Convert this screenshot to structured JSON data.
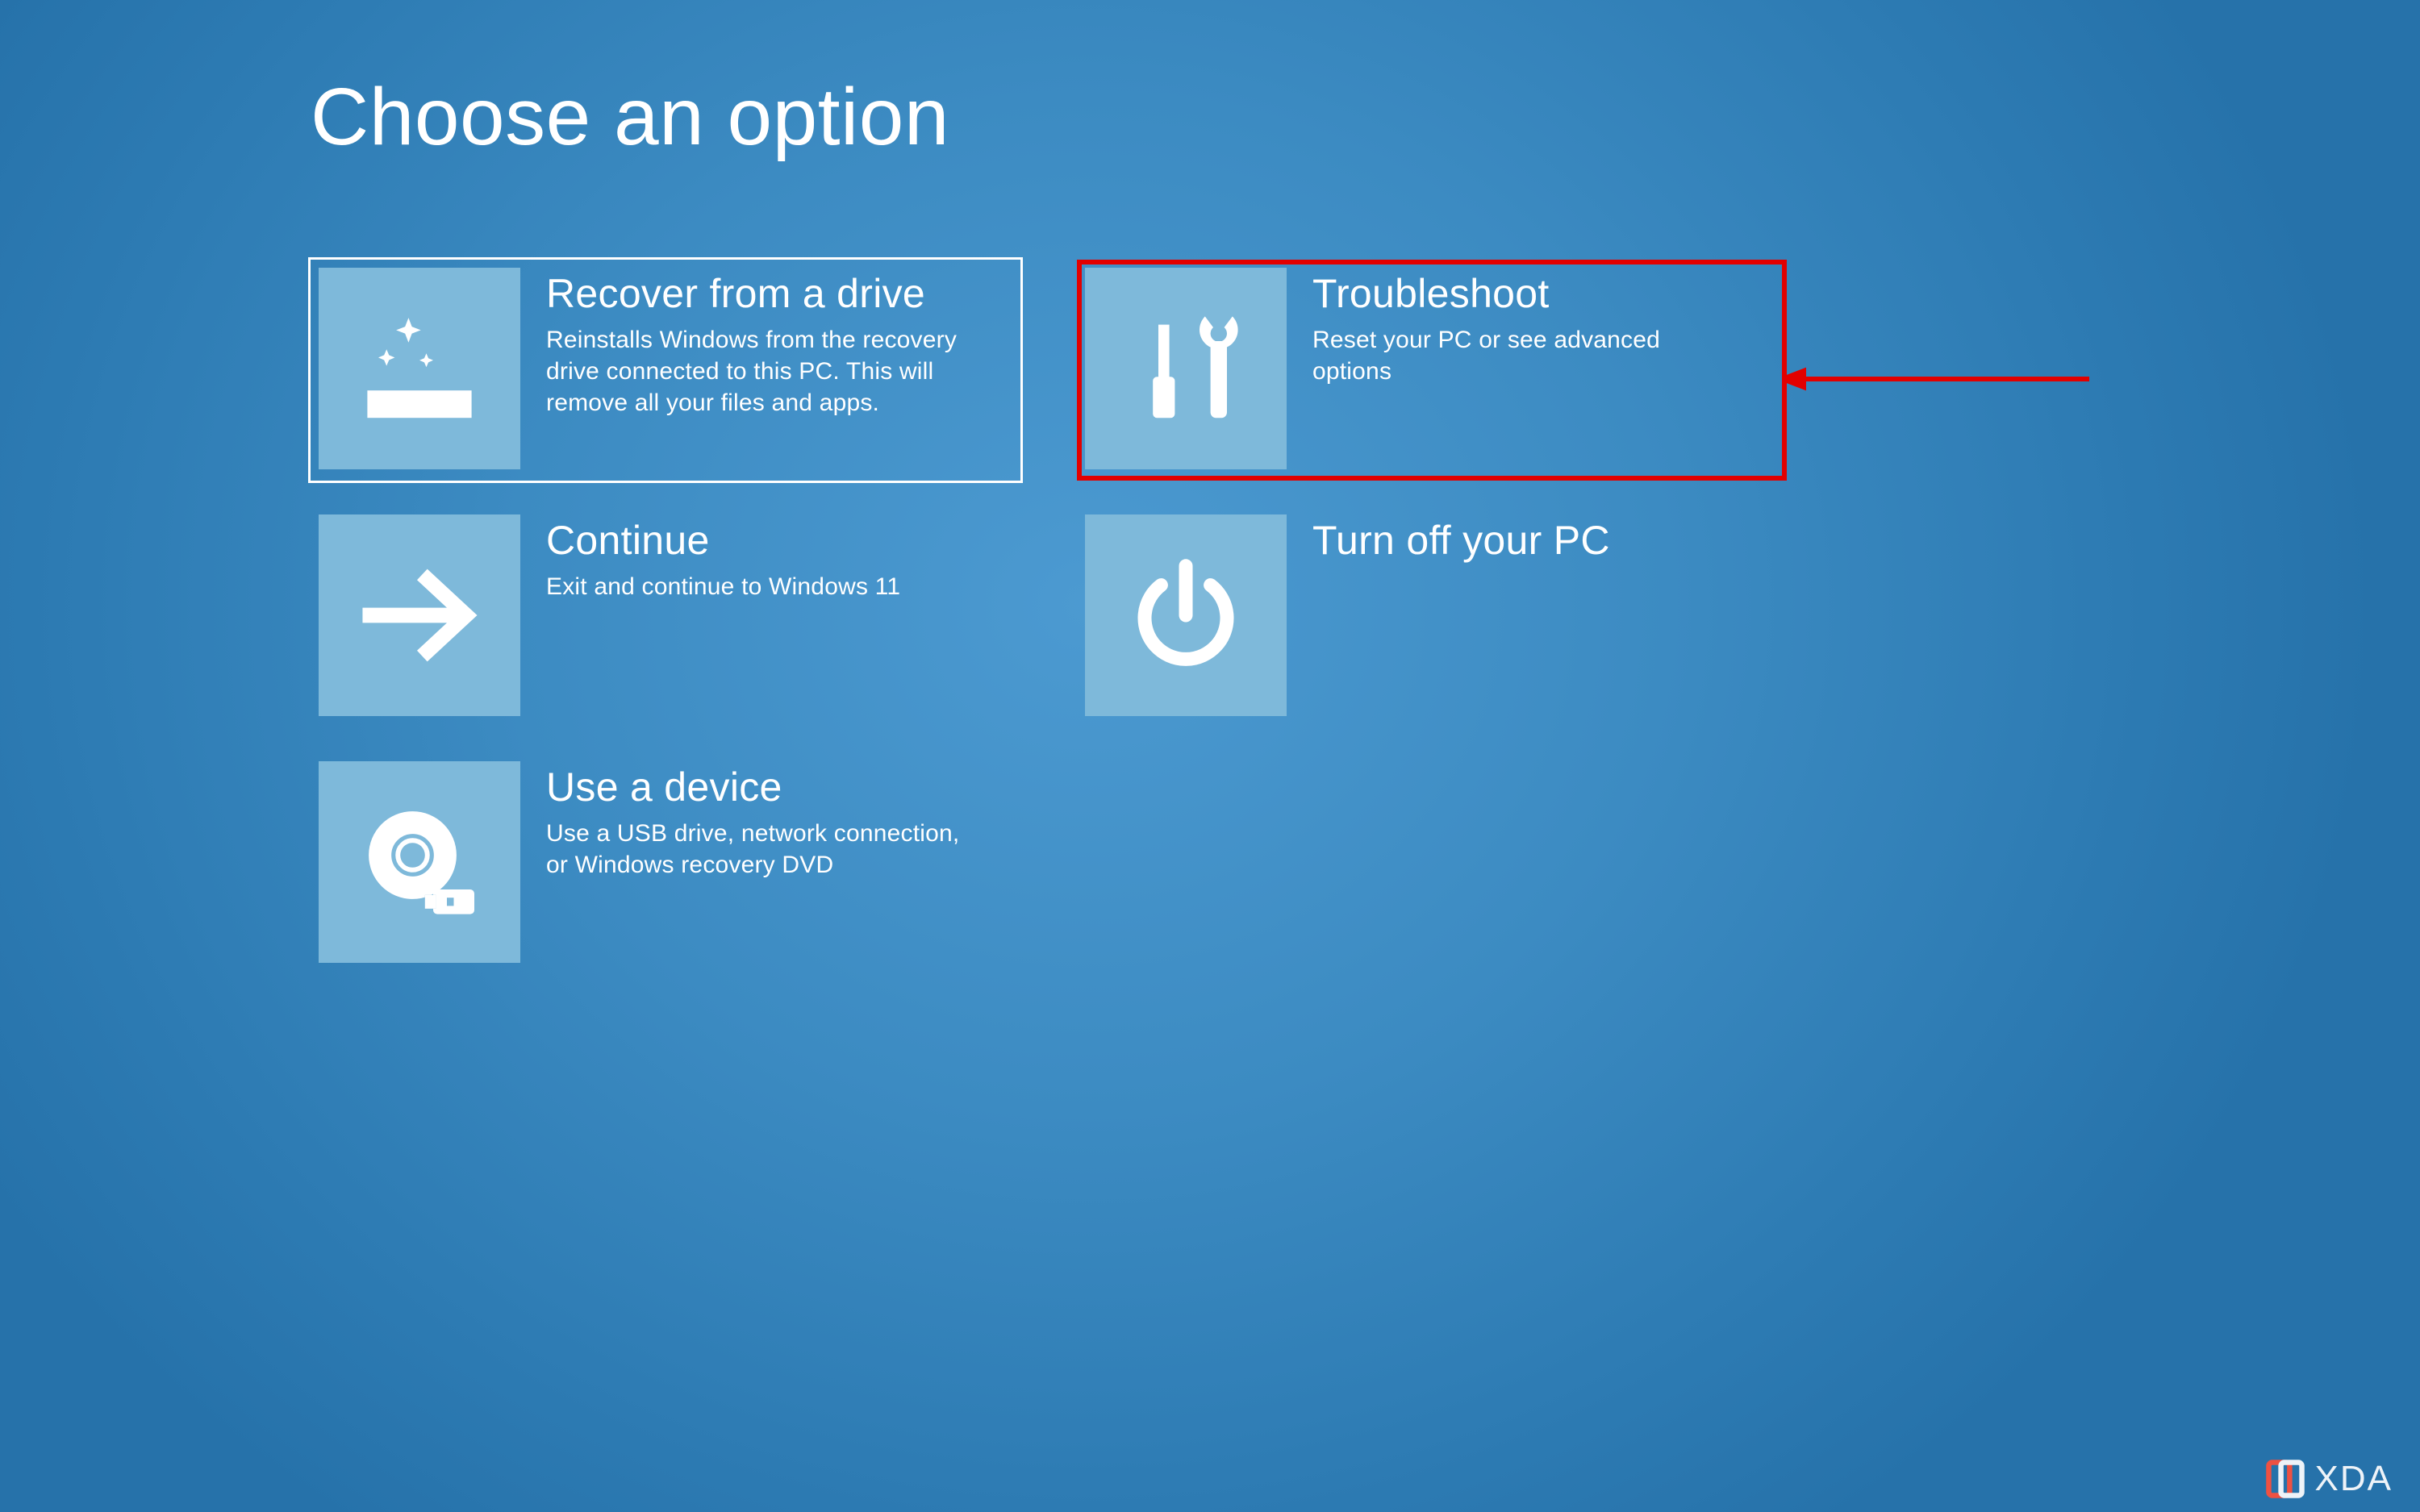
{
  "page_title": "Choose an option",
  "options": [
    {
      "id": "recover-from-drive",
      "title": "Recover from a drive",
      "description": "Reinstalls Windows from the recovery drive connected to this PC. This will remove all your files and apps.",
      "icon": "drive-sparkle-icon",
      "selected": true,
      "highlighted": false
    },
    {
      "id": "troubleshoot",
      "title": "Troubleshoot",
      "description": "Reset your PC or see advanced options",
      "icon": "tools-icon",
      "selected": false,
      "highlighted": true
    },
    {
      "id": "continue",
      "title": "Continue",
      "description": "Exit and continue to Windows 11",
      "icon": "arrow-right-icon",
      "selected": false,
      "highlighted": false
    },
    {
      "id": "turn-off",
      "title": "Turn off your PC",
      "description": "",
      "icon": "power-icon",
      "selected": false,
      "highlighted": false
    },
    {
      "id": "use-a-device",
      "title": "Use a device",
      "description": "Use a USB drive, network connection, or Windows recovery DVD",
      "icon": "disc-usb-icon",
      "selected": false,
      "highlighted": false
    }
  ],
  "annotation": {
    "arrow_color": "#e20000",
    "highlight_color": "#e20000"
  },
  "watermark": {
    "text": "XDA"
  },
  "colors": {
    "background_primary": "#3c8bc2",
    "tile_icon_bg": "#7eb9da",
    "text": "#ffffff"
  }
}
